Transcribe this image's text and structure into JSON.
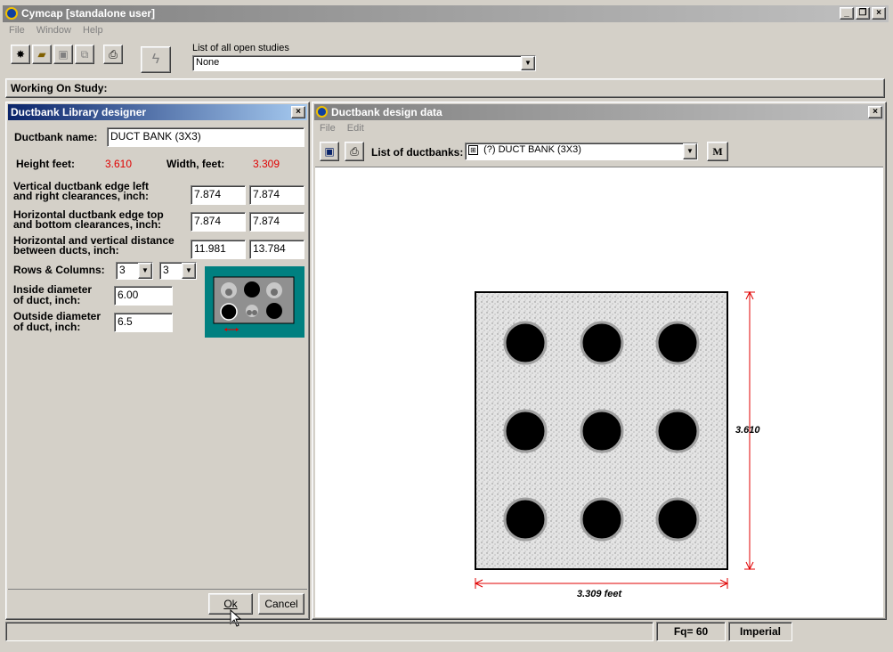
{
  "app": {
    "title": "Cymcap [standalone user]",
    "menu": [
      "File",
      "Window",
      "Help"
    ]
  },
  "toolbar": {
    "studies_label": "List of all open studies",
    "studies_value": "None"
  },
  "working_on": "Working On Study:",
  "library": {
    "title": "Ductbank Library designer",
    "name_label": "Ductbank name:",
    "name_value": "DUCT BANK (3X3)",
    "height_label": "Height feet:",
    "height_value": "3.610",
    "width_label": "Width, feet:",
    "width_value": "3.309",
    "vert_label_1": "Vertical ductbank edge left",
    "vert_label_2": "and right clearances, inch:",
    "vert_left": "7.874",
    "vert_right": "7.874",
    "horiz_label_1": "Horizontal ductbank edge top",
    "horiz_label_2": "and bottom clearances, inch:",
    "horiz_top": "7.874",
    "horiz_bottom": "7.874",
    "dist_label_1": "Horizontal and vertical distance",
    "dist_label_2": "between ducts, inch:",
    "dist_h": "11.981",
    "dist_v": "13.784",
    "rc_label": "Rows & Columns:",
    "rows": "3",
    "cols": "3",
    "inside_label_1": "Inside diameter",
    "inside_label_2": "of duct, inch:",
    "inside_value": "6.00",
    "outside_label_1": "Outside diameter",
    "outside_label_2": "of duct, inch:",
    "outside_value": "6.5",
    "ok": "Ok",
    "cancel": "Cancel"
  },
  "design": {
    "title": "Ductbank design data",
    "menu": [
      "File",
      "Edit"
    ],
    "list_label": "List of ductbanks:",
    "list_value": "(?) DUCT BANK (3X3)",
    "m_button": "M",
    "height_dim": "3.610",
    "width_dim": "3.309 feet"
  },
  "status": {
    "fq": "Fq= 60",
    "units": "Imperial"
  },
  "colors": {
    "accent_red": "#e00000",
    "teal": "#008080",
    "titlebar_active": "#0a246a"
  }
}
